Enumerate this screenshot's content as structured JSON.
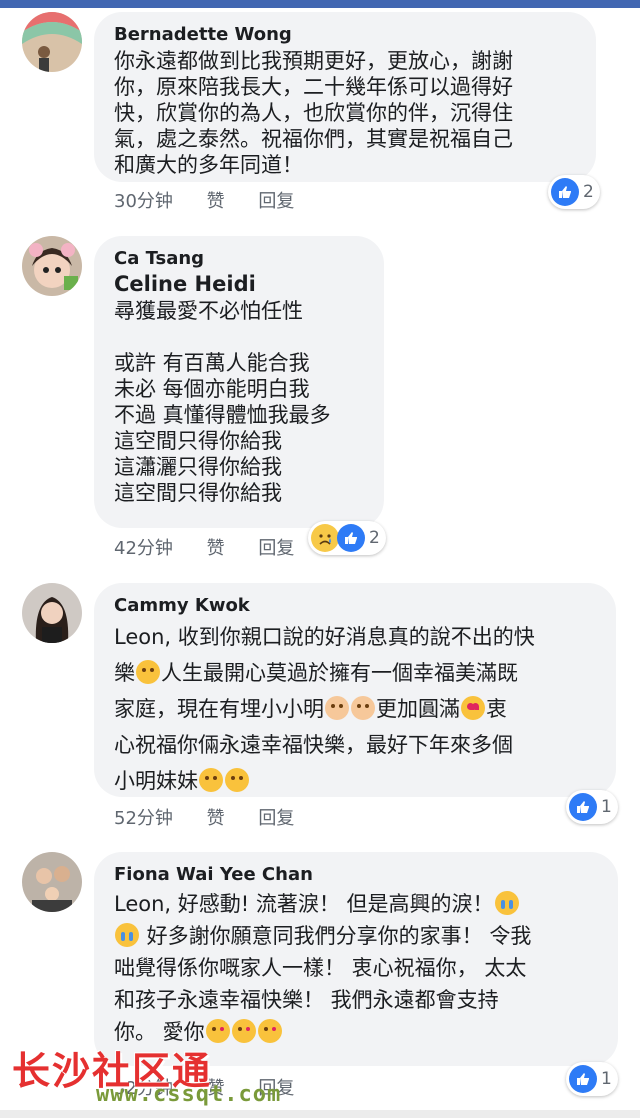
{
  "theme": {
    "accent": "#4267b2",
    "like_blue": "#2e7bf6",
    "bubble_bg": "#f2f3f5",
    "meta_gray": "#606770"
  },
  "comments": [
    {
      "author": "Bernadette Wong",
      "text": "你永遠都做到比我預期更好，更放心，謝謝\n你，原來陪我長大，二十幾年係可以過得好\n快，欣賞你的為人，也欣賞你的伴，沉得住\n氣，處之泰然。祝福你們，其實是祝福自己\n和廣大的多年同道！",
      "time": "30分钟",
      "like": "赞",
      "reply": "回复",
      "reactions": {
        "icons": [
          "like-icon"
        ],
        "count": "2"
      }
    },
    {
      "author": "Ca Tsang",
      "tag": "Celine Heidi",
      "text": "尋獲最愛不必怕任性\n\n或許 有百萬人能合我\n未必 每個亦能明白我\n不過 真懂得體恤我最多\n這空間只得你給我\n這瀟灑只得你給我\n這空間只得你給我",
      "time": "42分钟",
      "like": "赞",
      "reply": "回复",
      "reactions": {
        "icons": [
          "sad-icon",
          "like-icon"
        ],
        "count": "2"
      }
    },
    {
      "author": "Cammy Kwok",
      "text_parts": [
        "Leon, 收到你親口說的好消息真的說不出的快\n樂",
        "人生最開心莫過於擁有一個幸福美滿既\n家庭，現在有埋小小明",
        "更加圓滿",
        "衷\n心祝福你倆永遠幸福快樂，最好下年來多個\n小明妹妹"
      ],
      "time": "52分钟",
      "like": "赞",
      "reply": "回复",
      "reactions": {
        "icons": [
          "like-icon"
        ],
        "count": "1"
      }
    },
    {
      "author": "Fiona Wai Yee Chan",
      "text_parts": [
        "Leon, 好感動! 流著淚！ 但是高興的淚！",
        "\n",
        " 好多謝你願意同我們分享你的家事！ 令我\n咄覺得係你嘅家人一樣！ 衷心祝福你， 太太\n和孩子永遠幸福快樂！ 我們永遠都會支持\n你。 愛你"
      ],
      "time": "32分钟",
      "like": "赞",
      "reply": "回复",
      "reactions": {
        "icons": [
          "like-icon"
        ],
        "count": "1"
      }
    }
  ],
  "watermark": {
    "text": "长沙社区通",
    "url": "www.cssqt.com"
  }
}
